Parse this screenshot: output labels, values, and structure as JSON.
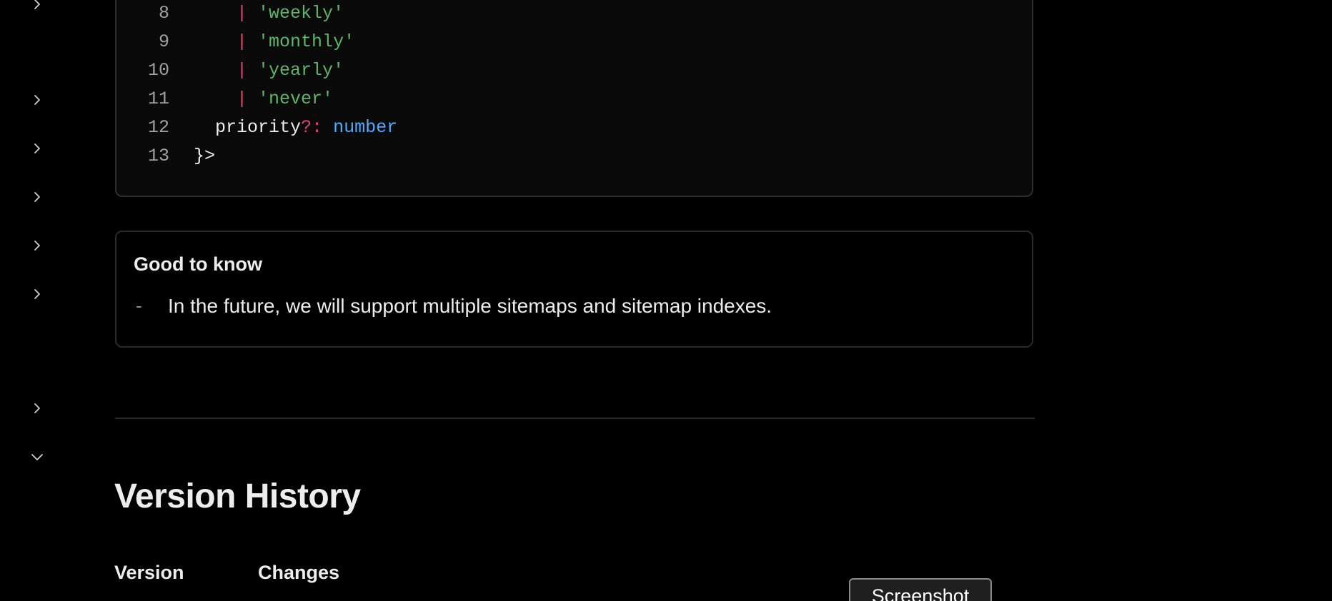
{
  "sidebar": {
    "chevrons": [
      {
        "icon": "chevron-right-icon"
      },
      {
        "icon": "chevron-right-icon"
      },
      {
        "icon": "chevron-right-icon"
      },
      {
        "icon": "chevron-right-icon"
      },
      {
        "icon": "chevron-right-icon"
      },
      {
        "icon": "chevron-right-icon"
      },
      {
        "icon": "chevron-right-icon"
      },
      {
        "icon": "chevron-down-icon"
      }
    ]
  },
  "code": {
    "lines": [
      {
        "num": "8",
        "pipe": "|",
        "str": "'weekly'"
      },
      {
        "num": "9",
        "pipe": "|",
        "str": "'monthly'"
      },
      {
        "num": "10",
        "pipe": "|",
        "str": "'yearly'"
      },
      {
        "num": "11",
        "pipe": "|",
        "str": "'never'"
      },
      {
        "num": "12",
        "key": "priority",
        "opt": "?:",
        "type": "number"
      },
      {
        "num": "13",
        "punc": "}>"
      }
    ]
  },
  "callout": {
    "title": "Good to know",
    "bullet": "-",
    "text": "In the future, we will support multiple sitemaps and sitemap indexes."
  },
  "version_history": {
    "title": "Version History",
    "columns": [
      "Version",
      "Changes"
    ]
  },
  "overlay": {
    "screenshot_label": "Screenshot"
  },
  "colors": {
    "background": "#000000",
    "string": "#5fb36a",
    "keyword": "#e5446d",
    "type": "#52a8ff"
  }
}
